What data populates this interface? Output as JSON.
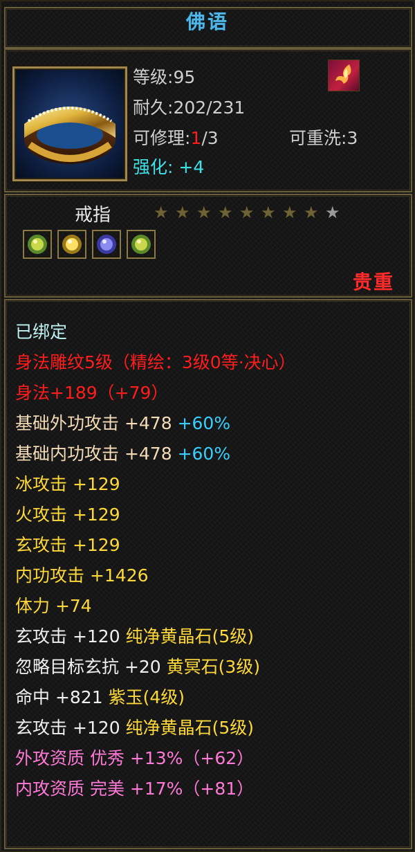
{
  "title": "佛语",
  "item": {
    "level_label": "等级",
    "level_value": ":95",
    "durability_label": "耐久",
    "durability_value": ":202/231",
    "repair_label": "可修理:",
    "repair_current": "1",
    "repair_total": "/3",
    "rewash_label": "可重洗:",
    "rewash_value": "3",
    "enhance_label": "强化:",
    "enhance_value": "+4",
    "icon": "ring-icon",
    "skill_icon": "flame-phoenix-icon",
    "name": "戒指",
    "stars": {
      "filled": 8,
      "total": 9
    },
    "gems": [
      "green-gem-icon",
      "yellow-gem-icon",
      "purple-gem-icon",
      "green-gem-icon"
    ],
    "rarity": "贵重"
  },
  "stats": [
    {
      "parts": [
        {
          "text": "已绑定",
          "color": "cyan"
        }
      ]
    },
    {
      "parts": [
        {
          "text": "身法雕纹5级（精绘：3级0等·决心）",
          "color": "red"
        }
      ]
    },
    {
      "parts": [
        {
          "text": "身法+189（+79）",
          "color": "red"
        }
      ]
    },
    {
      "parts": [
        {
          "text": "基础外功攻击 +478 ",
          "color": "beige"
        },
        {
          "text": "+60%",
          "color": "accent"
        }
      ]
    },
    {
      "parts": [
        {
          "text": "基础内功攻击 +478 ",
          "color": "beige"
        },
        {
          "text": "+60%",
          "color": "accent"
        }
      ]
    },
    {
      "parts": [
        {
          "text": "冰攻击 +129",
          "color": "yellow"
        }
      ]
    },
    {
      "parts": [
        {
          "text": "火攻击 +129",
          "color": "yellow"
        }
      ]
    },
    {
      "parts": [
        {
          "text": "玄攻击 +129",
          "color": "yellow"
        }
      ]
    },
    {
      "parts": [
        {
          "text": "内功攻击 +1426",
          "color": "yellow"
        }
      ]
    },
    {
      "parts": [
        {
          "text": "体力 +74",
          "color": "yellow"
        }
      ]
    },
    {
      "parts": [
        {
          "text": "玄攻击 +120 ",
          "color": "white"
        },
        {
          "text": "纯净黄晶石(5级)",
          "color": "yellow"
        }
      ]
    },
    {
      "parts": [
        {
          "text": "忽略目标玄抗 +20 ",
          "color": "white"
        },
        {
          "text": "黄冥石(3级)",
          "color": "yellow"
        }
      ]
    },
    {
      "parts": [
        {
          "text": "命中 +821 ",
          "color": "white"
        },
        {
          "text": "紫玉(4级)",
          "color": "yellow"
        }
      ]
    },
    {
      "parts": [
        {
          "text": "玄攻击 +120 ",
          "color": "white"
        },
        {
          "text": "纯净黄晶石(5级)",
          "color": "yellow"
        }
      ]
    },
    {
      "parts": [
        {
          "text": "外攻资质  优秀 +13%（+62）",
          "color": "pink"
        }
      ]
    },
    {
      "parts": [
        {
          "text": "内攻资质  完美 +17%（+81）",
          "color": "pink"
        }
      ]
    }
  ]
}
